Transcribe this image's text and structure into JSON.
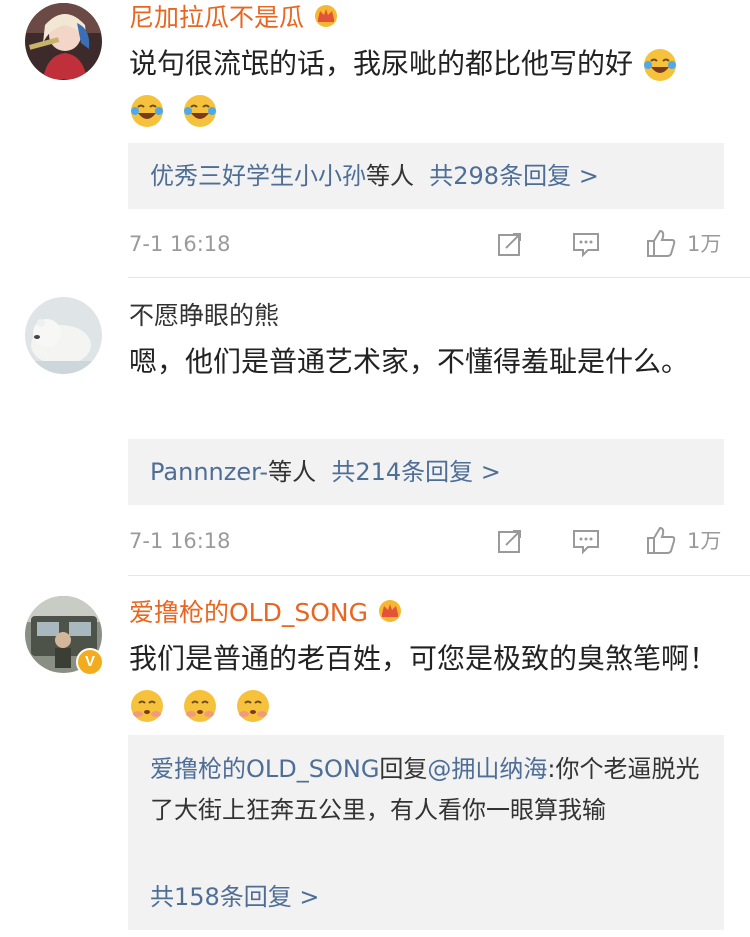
{
  "comments": [
    {
      "username": "尼加拉瓜不是瓜",
      "text": "说句很流氓的话，我尿呲的都比他写的好",
      "reply_who": "优秀三好学生小小孙",
      "reply_who_suffix": "等人",
      "reply_count": "共298条回复 >",
      "time": "7-1 16:18",
      "likes": "1万"
    },
    {
      "username": "不愿睁眼的熊",
      "text": "嗯，他们是普通艺术家，不懂得羞耻是什么。",
      "reply_who": "Pannnzer-",
      "reply_who_suffix": "等人",
      "reply_count": "共214条回复 >",
      "time": "7-1 16:18",
      "likes": "1万"
    },
    {
      "username": "爱撸枪的OLD_SONG",
      "text": "我们是普通的老百姓，可您是极致的臭煞笔啊！",
      "reply_author": "爱撸枪的OLD_SONG",
      "reply_verb": "回复",
      "reply_target": "@拥山纳海",
      "reply_body": ":你个老逼脱光了大街上狂奔五公里，有人看你一眼算我输",
      "reply_count": "共158条回复 >",
      "verified_badge": "V"
    }
  ],
  "icons": {
    "crown": "vip-crown-icon",
    "laugh_cry": "tears-of-joy-emoji",
    "blush": "blushing-face-emoji",
    "repost": "repost-icon",
    "comment": "comment-icon",
    "like": "thumbs-up-icon"
  },
  "colors": {
    "vip_name": "#e8661f",
    "link_blue": "#4e6e96",
    "meta_gray": "#9a9a9a",
    "reply_bg": "#f2f2f2"
  }
}
